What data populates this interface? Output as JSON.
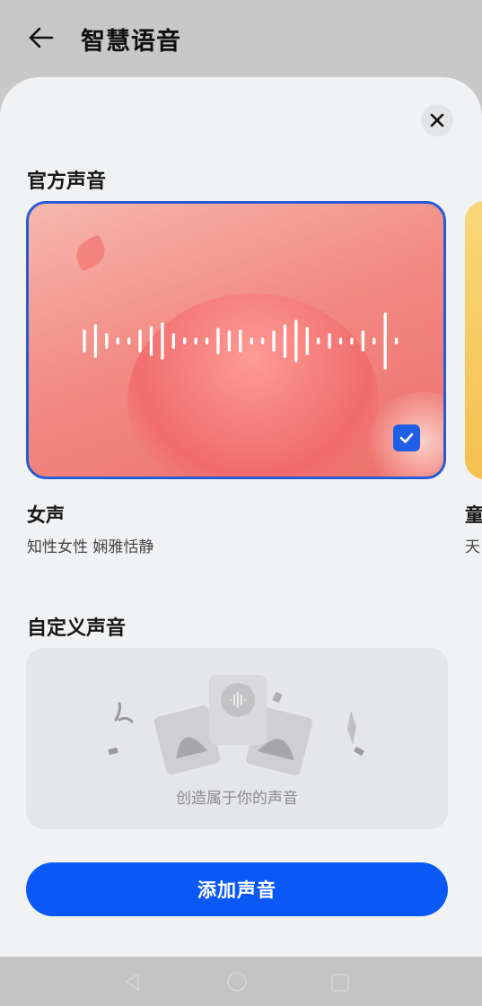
{
  "header": {
    "title": "智慧语音",
    "back_icon": "back-arrow-icon"
  },
  "sheet": {
    "close_icon": "close-icon",
    "official_section": {
      "title": "官方声音",
      "voices": [
        {
          "name": "女声",
          "description": "知性女性 娴雅恬静",
          "selected": true,
          "accent": "#f28c84"
        },
        {
          "name": "童",
          "description": "天",
          "selected": false,
          "accent": "#f5c04f"
        }
      ]
    },
    "custom_section": {
      "title": "自定义声音",
      "empty_text": "创造属于你的声音"
    },
    "add_button": {
      "label": "添加声音",
      "color": "#0a59f7"
    }
  },
  "navbar": {
    "back_icon": "nav-back-icon",
    "home_icon": "nav-home-icon",
    "recent_icon": "nav-recent-icon"
  }
}
